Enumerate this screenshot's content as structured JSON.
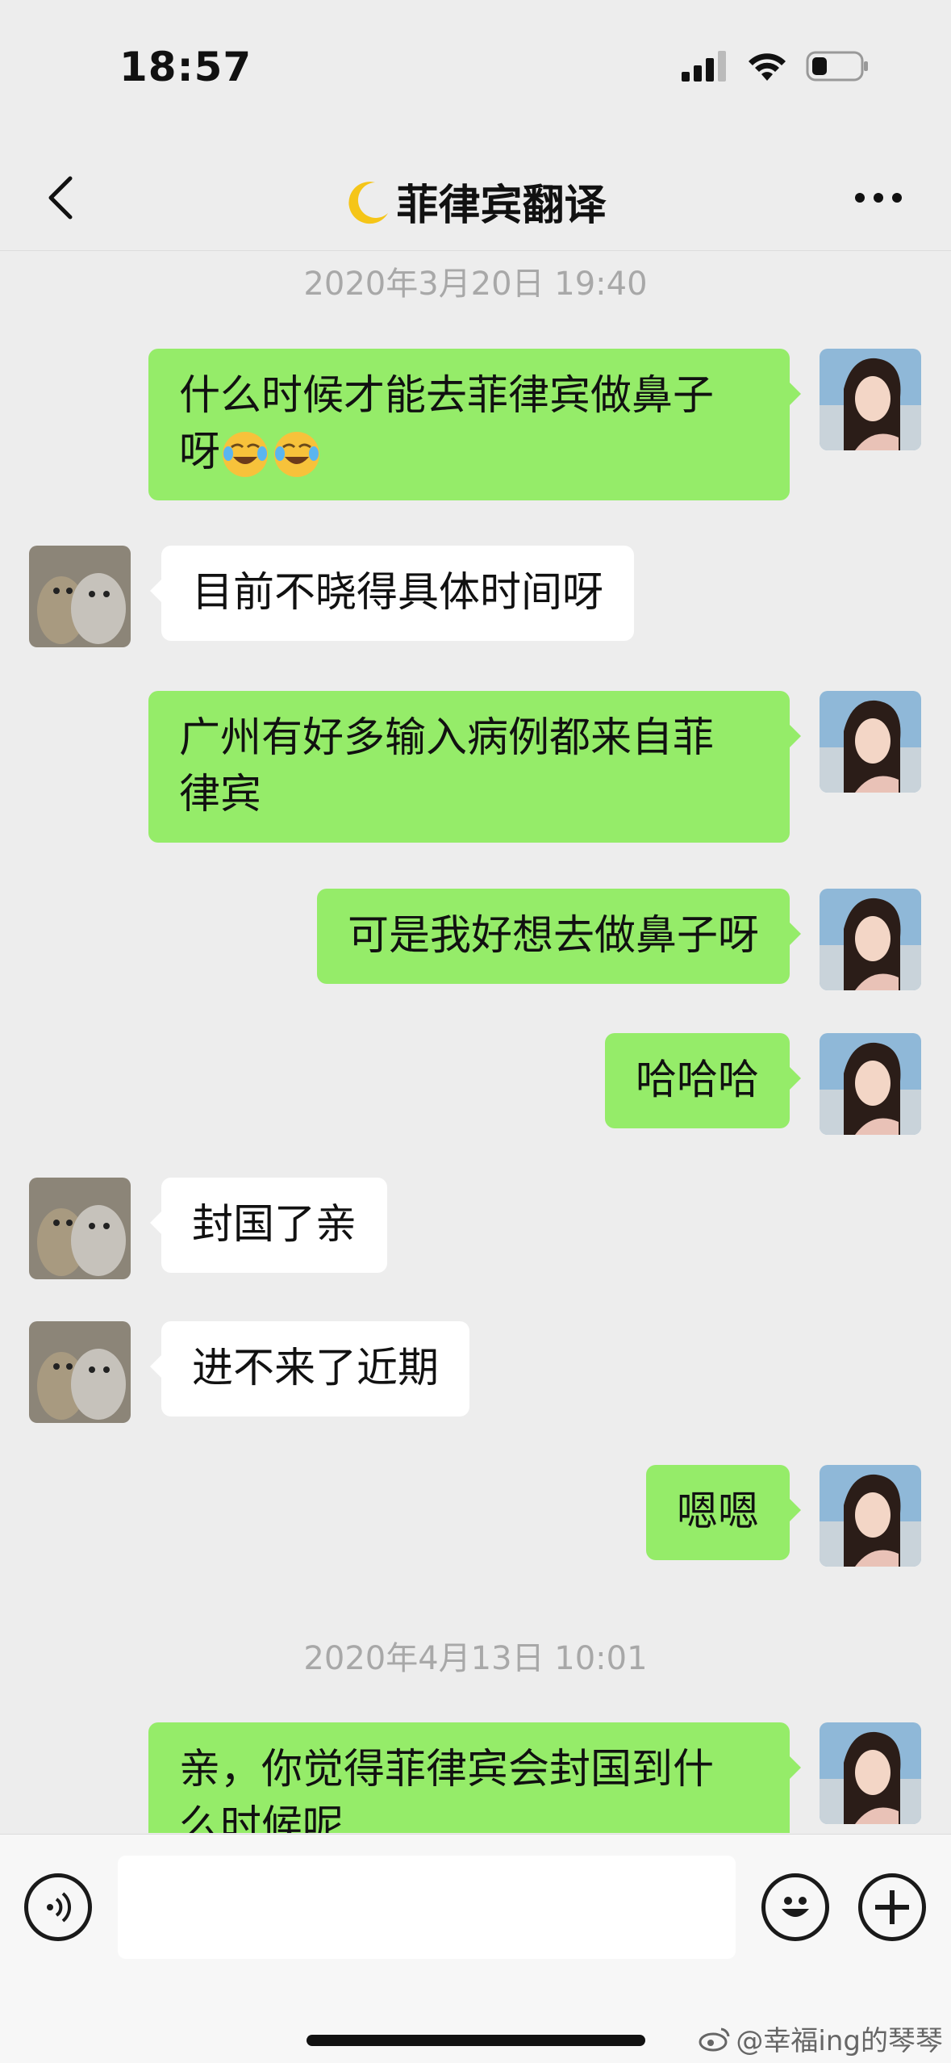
{
  "status_bar": {
    "time": "18:57"
  },
  "nav": {
    "title": "菲律宾翻译"
  },
  "chat": {
    "timestamps": [
      "2020年3月20日 19:40",
      "2020年4月13日 10:01"
    ],
    "messages": [
      {
        "side": "out",
        "line1": "什么时候才能去菲律宾做鼻子",
        "line2": "呀"
      },
      {
        "side": "in",
        "text": "目前不晓得具体时间呀"
      },
      {
        "side": "out",
        "line1": "广州有好多输入病例都来自菲",
        "line2": "律宾"
      },
      {
        "side": "out",
        "text": "可是我好想去做鼻子呀"
      },
      {
        "side": "out",
        "text": "哈哈哈"
      },
      {
        "side": "in",
        "text": "封国了亲"
      },
      {
        "side": "in",
        "text": "进不来了近期"
      },
      {
        "side": "out",
        "text": "嗯嗯"
      },
      {
        "side": "out",
        "line1": "亲，你觉得菲律宾会封国到什",
        "line2": "么时候呢"
      }
    ]
  },
  "watermark": "@幸福ing的琴琴",
  "colors": {
    "outgoing_bubble": "#95ec69",
    "incoming_bubble": "#ffffff",
    "background": "#ededed"
  }
}
